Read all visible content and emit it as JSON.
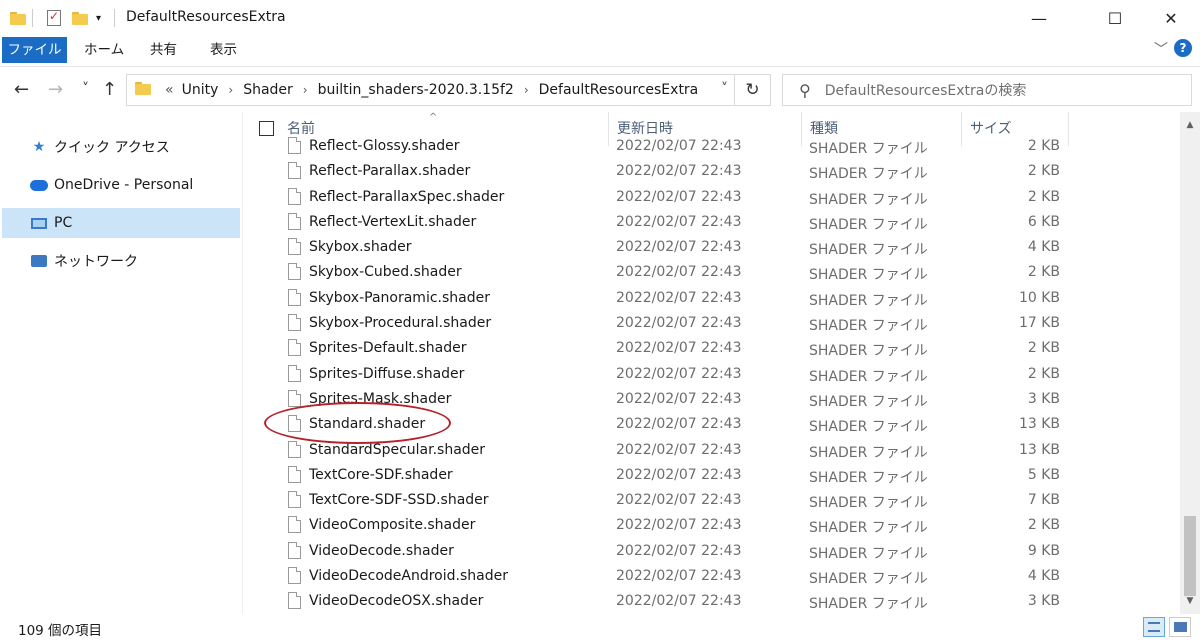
{
  "window": {
    "title": "DefaultResourcesExtra",
    "minimize": "—",
    "maximize": "☐",
    "close": "✕"
  },
  "ribbon": {
    "tabs": [
      "ファイル",
      "ホーム",
      "共有",
      "表示"
    ],
    "expand": "﹀",
    "help": "?"
  },
  "nav": {
    "back": "←",
    "forward": "→",
    "recent": "˅",
    "up": "↑",
    "overflow": "«",
    "path": [
      "Unity",
      "Shader",
      "builtin_shaders-2020.3.15f2",
      "DefaultResourcesExtra"
    ],
    "path_sep": "›",
    "dropdown": "˅",
    "refresh": "↻"
  },
  "search": {
    "placeholder": "DefaultResourcesExtraの検索"
  },
  "sidebar": {
    "items": [
      {
        "label": "クイック アクセス"
      },
      {
        "label": "OneDrive - Personal"
      },
      {
        "label": "PC"
      },
      {
        "label": "ネットワーク"
      }
    ]
  },
  "columns": {
    "name": "名前",
    "date": "更新日時",
    "type": "種類",
    "size": "サイズ",
    "sort_indicator": "^"
  },
  "files": [
    {
      "name": "Reflect-Glossy.shader",
      "date": "2022/02/07 22:43",
      "type": "SHADER ファイル",
      "size": "2 KB"
    },
    {
      "name": "Reflect-Parallax.shader",
      "date": "2022/02/07 22:43",
      "type": "SHADER ファイル",
      "size": "2 KB"
    },
    {
      "name": "Reflect-ParallaxSpec.shader",
      "date": "2022/02/07 22:43",
      "type": "SHADER ファイル",
      "size": "2 KB"
    },
    {
      "name": "Reflect-VertexLit.shader",
      "date": "2022/02/07 22:43",
      "type": "SHADER ファイル",
      "size": "6 KB"
    },
    {
      "name": "Skybox.shader",
      "date": "2022/02/07 22:43",
      "type": "SHADER ファイル",
      "size": "4 KB"
    },
    {
      "name": "Skybox-Cubed.shader",
      "date": "2022/02/07 22:43",
      "type": "SHADER ファイル",
      "size": "2 KB"
    },
    {
      "name": "Skybox-Panoramic.shader",
      "date": "2022/02/07 22:43",
      "type": "SHADER ファイル",
      "size": "10 KB"
    },
    {
      "name": "Skybox-Procedural.shader",
      "date": "2022/02/07 22:43",
      "type": "SHADER ファイル",
      "size": "17 KB"
    },
    {
      "name": "Sprites-Default.shader",
      "date": "2022/02/07 22:43",
      "type": "SHADER ファイル",
      "size": "2 KB"
    },
    {
      "name": "Sprites-Diffuse.shader",
      "date": "2022/02/07 22:43",
      "type": "SHADER ファイル",
      "size": "2 KB"
    },
    {
      "name": "Sprites-Mask.shader",
      "date": "2022/02/07 22:43",
      "type": "SHADER ファイル",
      "size": "3 KB"
    },
    {
      "name": "Standard.shader",
      "date": "2022/02/07 22:43",
      "type": "SHADER ファイル",
      "size": "13 KB"
    },
    {
      "name": "StandardSpecular.shader",
      "date": "2022/02/07 22:43",
      "type": "SHADER ファイル",
      "size": "13 KB"
    },
    {
      "name": "TextCore-SDF.shader",
      "date": "2022/02/07 22:43",
      "type": "SHADER ファイル",
      "size": "5 KB"
    },
    {
      "name": "TextCore-SDF-SSD.shader",
      "date": "2022/02/07 22:43",
      "type": "SHADER ファイル",
      "size": "7 KB"
    },
    {
      "name": "VideoComposite.shader",
      "date": "2022/02/07 22:43",
      "type": "SHADER ファイル",
      "size": "2 KB"
    },
    {
      "name": "VideoDecode.shader",
      "date": "2022/02/07 22:43",
      "type": "SHADER ファイル",
      "size": "9 KB"
    },
    {
      "name": "VideoDecodeAndroid.shader",
      "date": "2022/02/07 22:43",
      "type": "SHADER ファイル",
      "size": "4 KB"
    },
    {
      "name": "VideoDecodeOSX.shader",
      "date": "2022/02/07 22:43",
      "type": "SHADER ファイル",
      "size": "3 KB"
    }
  ],
  "highlight": {
    "file": "Standard.shader",
    "color": "#b3242c"
  },
  "scrollbar": {
    "up": "▲",
    "down": "▼"
  },
  "status": {
    "count": "109 個の項目"
  },
  "colors": {
    "accent": "#1a6cc4",
    "selected": "#cce4f7"
  }
}
